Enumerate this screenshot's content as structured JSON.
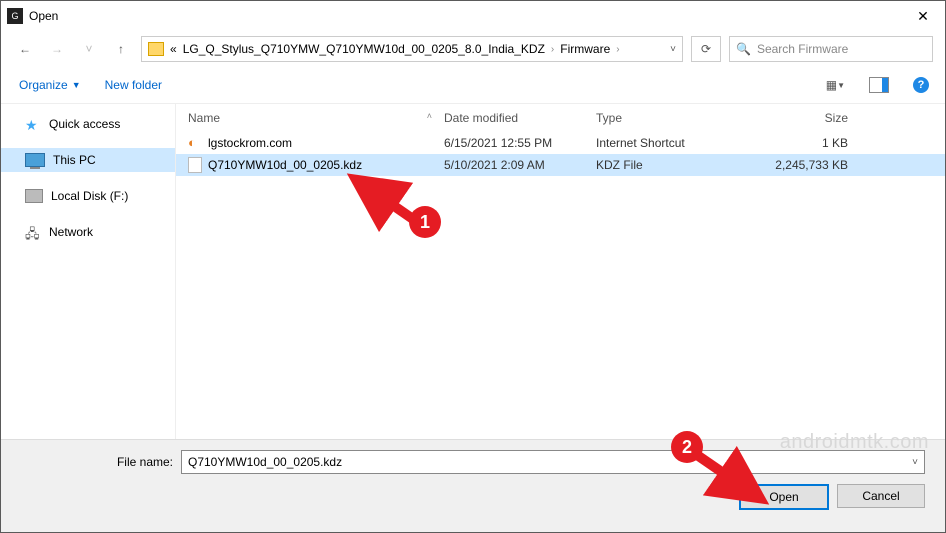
{
  "window": {
    "title": "Open"
  },
  "address": {
    "prefix": "«",
    "parent": "LG_Q_Stylus_Q710YMW_Q710YMW10d_00_0205_8.0_India_KDZ",
    "current": "Firmware",
    "search_placeholder": "Search Firmware"
  },
  "toolbar": {
    "organize": "Organize",
    "new_folder": "New folder"
  },
  "sidebar": {
    "quick_access": "Quick access",
    "this_pc": "This PC",
    "local_disk": "Local Disk (F:)",
    "network": "Network"
  },
  "columns": {
    "name": "Name",
    "date": "Date modified",
    "type": "Type",
    "size": "Size"
  },
  "files": [
    {
      "name": "lgstockrom.com",
      "date": "6/15/2021 12:55 PM",
      "type": "Internet Shortcut",
      "size": "1 KB",
      "selected": false,
      "icon": "shortcut"
    },
    {
      "name": "Q710YMW10d_00_0205.kdz",
      "date": "5/10/2021 2:09 AM",
      "type": "KDZ File",
      "size": "2,245,733 KB",
      "selected": true,
      "icon": "file"
    }
  ],
  "footer": {
    "label": "File name:",
    "value": "Q710YMW10d_00_0205.kdz",
    "open": "Open",
    "cancel": "Cancel"
  },
  "annotations": {
    "marker1": "1",
    "marker2": "2"
  },
  "watermark": "androidmtk.com"
}
